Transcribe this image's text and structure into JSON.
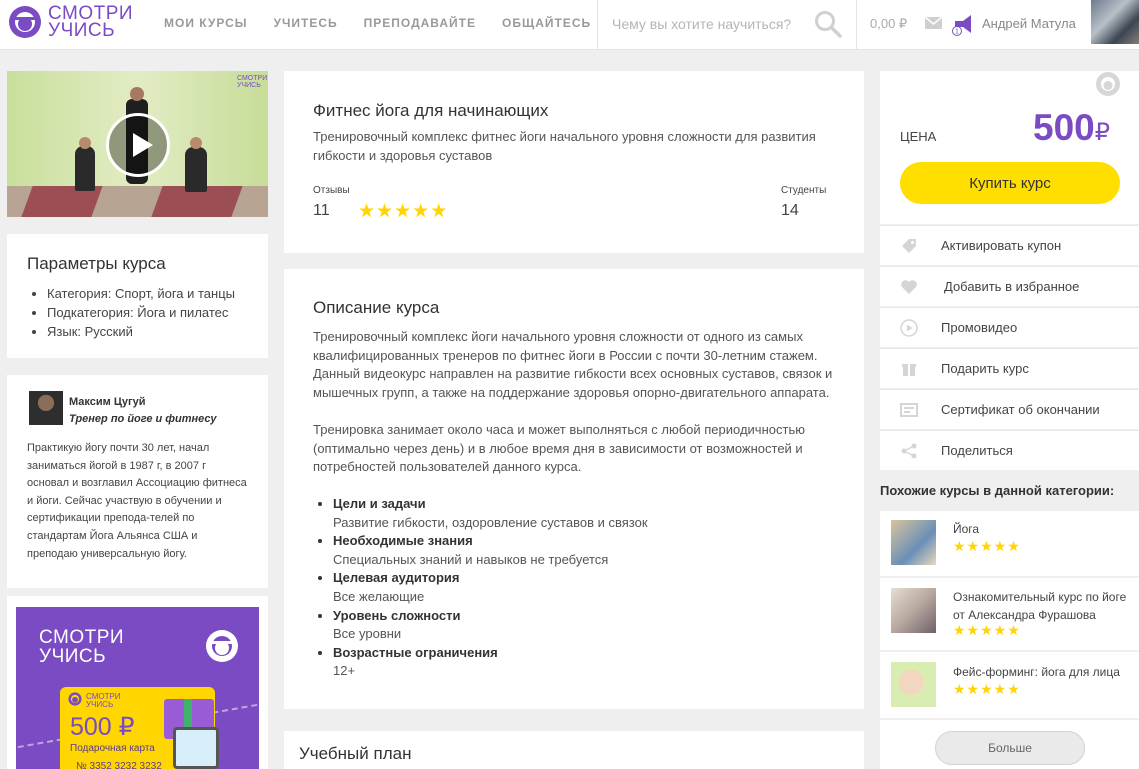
{
  "header": {
    "logo_line1": "СМОТРИ",
    "logo_line2": "УЧИСЬ",
    "nav": [
      "Мои курсы",
      "Учитесь",
      "Преподавайте",
      "Общайтесь"
    ],
    "search_placeholder": "Чему вы хотите научиться?",
    "balance": "0,00 ₽",
    "user_name": "Андрей Матула"
  },
  "video": {
    "logo_line1": "СМОТРИ",
    "logo_line2": "УЧИСЬ"
  },
  "params": {
    "title": "Параметры курса",
    "items": [
      "Категория: Спорт, йога и танцы",
      "Подкатегория: Йога и пилатес",
      "Язык: Русский"
    ]
  },
  "trainer": {
    "name": "Максим Цугуй",
    "role": "Тренер по йоге и фитнесу",
    "bio": "Практикую йогу почти 30 лет, начал заниматься йогой в 1987 г, в 2007 г основал и возглавил Ассоциацию фитнеса и йоги. Сейчас участвую в обучении и сертификации препода-телей по стандартам Йога Альянса США и преподаю универсальную йогу."
  },
  "promo": {
    "line1": "СМОТРИ",
    "line2": "УЧИСЬ",
    "card_brand1": "СМОТРИ",
    "card_brand2": "УЧИСЬ",
    "card_price": "500 ₽",
    "card_label": "Подарочная карта",
    "card_number": "№ 3352 3232 3232"
  },
  "course": {
    "title": "Фитнес йога для начинающих",
    "subtitle": "Тренировочный комплекс фитнес йоги начального уровня сложности для развития гибкости и здоровья суставов",
    "reviews_label": "Отзывы",
    "reviews_count": "11",
    "rating_stars": 5,
    "students_label": "Студенты",
    "students_count": "14"
  },
  "description": {
    "title": "Описание курса",
    "paragraph1": "Тренировочный комплекс йоги начального уровня сложности от одного из самых квалифицированных тренеров по фитнес йоги в России с почти 30-летним стажем. Данный видеокурс направлен на развитие гибкости всех основных суставов, связок и мышечных групп, а также на поддержание здоровья опорно-двигательного аппарата.",
    "paragraph2": "Тренировка занимает около часа и может выполняться с любой периодичностью (оптимально через день) и в любое время дня в зависимости от возможностей и потребностей пользователей данного курса.",
    "facts": [
      {
        "label": "Цели и задачи",
        "value": "Развитие гибкости, оздоровление суставов и связок"
      },
      {
        "label": "Необходимые знания",
        "value": "Специальных знаний и навыков не требуется"
      },
      {
        "label": "Целевая аудитория",
        "value": "Все желающие"
      },
      {
        "label": "Уровень сложности",
        "value": "Все уровни"
      },
      {
        "label": "Возрастные ограничения",
        "value": "12+"
      }
    ]
  },
  "plan": {
    "title": "Учебный план"
  },
  "purchase": {
    "price_label": "Цена",
    "price": "500",
    "currency": "₽",
    "buy_label": "Купить курс"
  },
  "actions": [
    {
      "label": "Активировать купон",
      "icon": "tag-icon"
    },
    {
      "label": "Добавить в избранное",
      "icon": "heart-icon"
    },
    {
      "label": "Промовидео",
      "icon": "play-circle-icon"
    },
    {
      "label": "Подарить курс",
      "icon": "gift-icon"
    },
    {
      "label": "Сертификат об окончании",
      "icon": "certificate-icon"
    },
    {
      "label": "Поделиться",
      "icon": "share-icon"
    }
  ],
  "similar": {
    "title": "Похожие курсы в данной категории:",
    "items": [
      {
        "name": "Йога",
        "stars": 5
      },
      {
        "name": "Ознакомительный курс по йоге от Александра Фурашова",
        "stars": 5
      },
      {
        "name": "Фейс-форминг: йога для лица",
        "stars": 5
      }
    ],
    "more_label": "Больше"
  },
  "colors": {
    "brand_purple": "#7b4bc4",
    "accent_yellow": "#ffde00",
    "star_yellow": "#ffd400",
    "background": "#efefef"
  }
}
